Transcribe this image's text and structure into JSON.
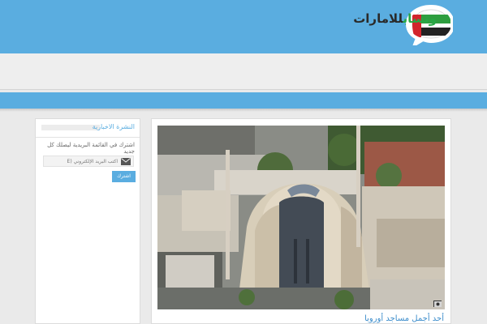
{
  "header": {
    "logo_word_dark": "للامارات",
    "logo_word_green": "وتساب",
    "logo_icon": "uae-flag-speech-bubble-icon",
    "background_color": "#5aade0"
  },
  "newsletter": {
    "title": "النشرة الاخبارية",
    "description": "اشترك في القائمة البريدية ليصلك كل جديد",
    "email_placeholder": "اكتب البريد الإلكتروني (E",
    "email_icon": "envelope-icon",
    "subscribe_label": "اشترك",
    "accent_color": "#5aade0"
  },
  "post": {
    "image_icon": "mosque-photo",
    "corner_icon": "camera-icon",
    "title": "أحد أجمل مساجد أوروبا"
  }
}
